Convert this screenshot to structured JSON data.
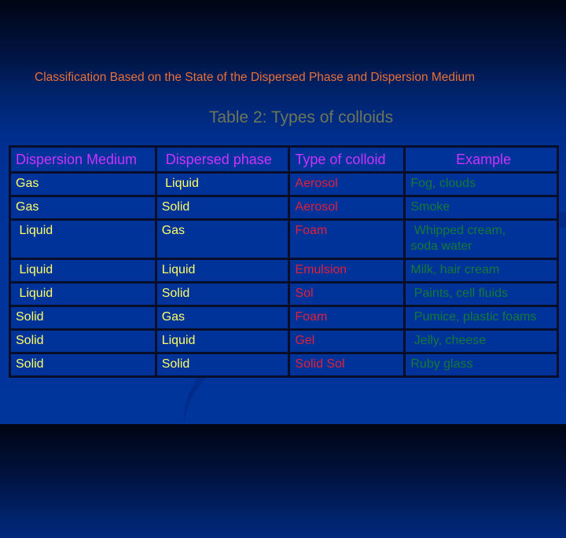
{
  "subtitle": "Classification Based on the State of the Dispersed Phase and Dispersion Medium",
  "table_title": "Table 2: Types of colloids",
  "colors": {
    "subtitle": "#e8703a",
    "table_title": "#6b7757",
    "header": "#cc33ff",
    "medium_phase": "#ffff66",
    "type": "#e0203c",
    "example": "#137a37",
    "table_bg": "#003399"
  },
  "table": {
    "headers": [
      "Dispersion Medium",
      " Dispersed phase",
      "Type of colloid",
      "Example"
    ],
    "rows": [
      {
        "medium": "Gas",
        "phase": " Liquid",
        "type": "Aerosol",
        "example": "Fog, clouds"
      },
      {
        "medium": "Gas",
        "phase": "Solid",
        "type": "Aerosol",
        "example": "Smoke"
      },
      {
        "medium": " Liquid",
        "phase": "Gas",
        "type": "Foam",
        "example": " Whipped cream, soda water"
      },
      {
        "medium": " Liquid",
        "phase": "Liquid",
        "type": "Emulsion",
        "example": "Milk, hair cream"
      },
      {
        "medium": " Liquid",
        "phase": "Solid",
        "type": "Sol",
        "example": " Paints, cell fluids"
      },
      {
        "medium": "Solid",
        "phase": "Gas",
        "type": "Foam",
        "example": " Pumice, plastic foams"
      },
      {
        "medium": "Solid",
        "phase": "Liquid",
        "type": "Gel",
        "example": " Jelly, cheese"
      },
      {
        "medium": "Solid",
        "phase": "Solid",
        "type": "Solid Sol",
        "example": "Ruby glass"
      }
    ]
  }
}
